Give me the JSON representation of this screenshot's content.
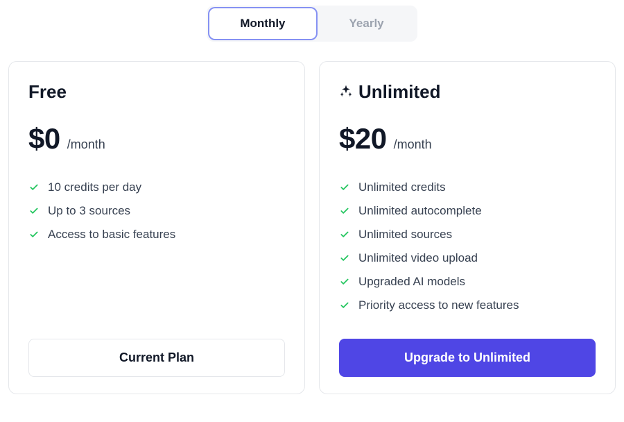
{
  "toggle": {
    "monthly": "Monthly",
    "yearly": "Yearly",
    "active": "monthly"
  },
  "plans": {
    "free": {
      "title": "Free",
      "price": "$0",
      "period": "/month",
      "features": [
        "10 credits per day",
        "Up to 3 sources",
        "Access to basic features"
      ],
      "cta": "Current Plan"
    },
    "unlimited": {
      "title": "Unlimited",
      "price": "$20",
      "period": "/month",
      "features": [
        "Unlimited credits",
        "Unlimited autocomplete",
        "Unlimited sources",
        "Unlimited video upload",
        "Upgraded AI models",
        "Priority access to new features"
      ],
      "cta": "Upgrade to Unlimited"
    }
  },
  "colors": {
    "accent": "#4f46e5",
    "toggle_ring": "#8591f3",
    "check": "#22c55e"
  }
}
